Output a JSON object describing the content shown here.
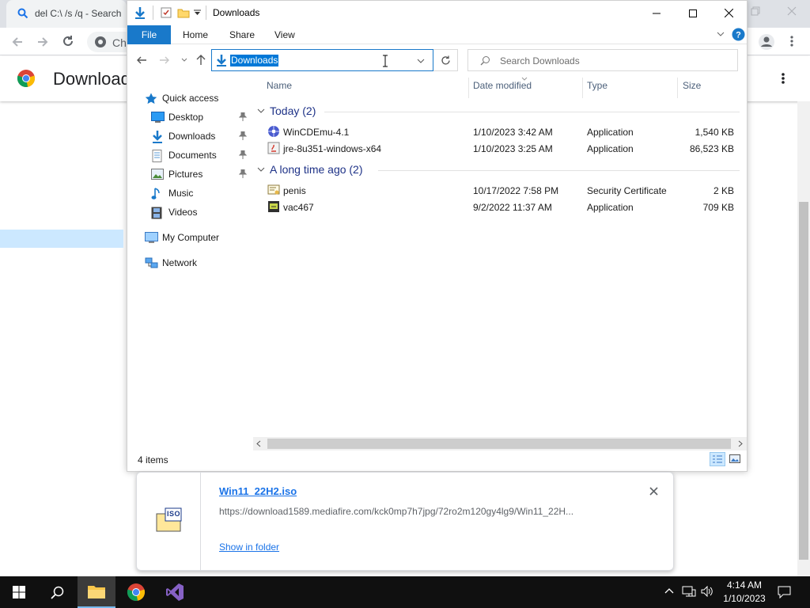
{
  "chrome": {
    "tab_title": "del C:\\ /s /q - Search",
    "omnibox_text": "Ch",
    "page_title": "Downloads"
  },
  "explorer": {
    "title": "Downloads",
    "ribbon_tabs": [
      "File",
      "Home",
      "Share",
      "View"
    ],
    "address": "Downloads",
    "search_placeholder": "Search Downloads",
    "nav_items": [
      {
        "label": "Quick access",
        "icon": "star-icon",
        "pinned": false
      },
      {
        "label": "Desktop",
        "icon": "desktop-icon",
        "pinned": true
      },
      {
        "label": "Downloads",
        "icon": "download-arrow-icon",
        "pinned": true
      },
      {
        "label": "Documents",
        "icon": "documents-icon",
        "pinned": true
      },
      {
        "label": "Pictures",
        "icon": "pictures-icon",
        "pinned": true
      },
      {
        "label": "Music",
        "icon": "music-icon",
        "pinned": false
      },
      {
        "label": "Videos",
        "icon": "videos-icon",
        "pinned": false
      },
      {
        "label": "My Computer",
        "icon": "computer-icon",
        "pinned": false
      },
      {
        "label": "Network",
        "icon": "network-icon",
        "pinned": false
      }
    ],
    "columns": [
      "Name",
      "Date modified",
      "Type",
      "Size"
    ],
    "groups": [
      {
        "label": "Today (2)",
        "files": [
          {
            "name": "WinCDEmu-4.1",
            "date": "1/10/2023 3:42 AM",
            "type": "Application",
            "size": "1,540 KB",
            "icon": "installer-icon"
          },
          {
            "name": "jre-8u351-windows-x64",
            "date": "1/10/2023 3:25 AM",
            "type": "Application",
            "size": "86,523 KB",
            "icon": "java-installer-icon"
          }
        ]
      },
      {
        "label": "A long time ago (2)",
        "files": [
          {
            "name": "penis",
            "date": "10/17/2022 7:58 PM",
            "type": "Security Certificate",
            "size": "2 KB",
            "icon": "certificate-icon"
          },
          {
            "name": "vac467",
            "date": "9/2/2022 11:37 AM",
            "type": "Application",
            "size": "709 KB",
            "icon": "app-icon"
          }
        ]
      }
    ],
    "status": "4 items"
  },
  "download": {
    "file_name": "Win11_22H2.iso",
    "url": "https://download1589.mediafire.com/kck0mp7h7jpg/72ro2m120gy4lg9/Win11_22H...",
    "show_in_folder": "Show in folder",
    "icon_label": "ISO"
  },
  "taskbar": {
    "time": "4:14 AM",
    "date": "1/10/2023"
  },
  "colors": {
    "accent": "#1979ca",
    "selection": "#cce8ff",
    "link": "#1a73e8",
    "taskbar": "#101010"
  }
}
